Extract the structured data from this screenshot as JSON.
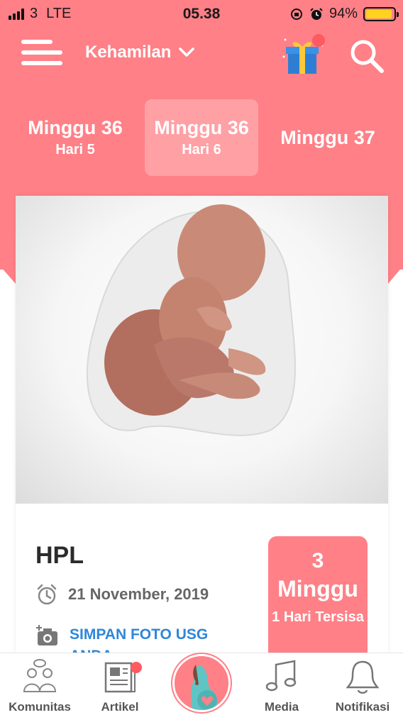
{
  "status_bar": {
    "carrier": "3",
    "network": "LTE",
    "time": "05.38",
    "battery_percent": "94%",
    "battery_level": 0.94,
    "battery_color": "#ffd21e"
  },
  "header": {
    "selector_label": "Kehamilan",
    "icons": [
      "menu-icon",
      "gift-icon",
      "search-icon",
      "chevron-down-icon"
    ],
    "accent_color": "#ff8087"
  },
  "week_tabs": [
    {
      "week": "Minggu 36",
      "day": "Hari 5"
    },
    {
      "week": "Minggu 36",
      "day": "Hari 6",
      "active": true
    },
    {
      "week": "Minggu 37",
      "day": ""
    }
  ],
  "card": {
    "hpl_title": "HPL",
    "due_date": "21 November, 2019",
    "save_usg_label": "SIMPAN FOTO USG ANDA",
    "countdown": {
      "number": "3",
      "unit": "Minggu",
      "remaining": "1 Hari Tersisa"
    }
  },
  "bottom_nav": {
    "items": [
      {
        "label": "Komunitas",
        "icon": "community-icon"
      },
      {
        "label": "Artikel",
        "icon": "article-icon",
        "badge": true
      },
      {
        "label": "",
        "icon": "pregnancy-icon"
      },
      {
        "label": "Media",
        "icon": "music-icon"
      },
      {
        "label": "Notifikasi",
        "icon": "bell-icon"
      }
    ]
  }
}
